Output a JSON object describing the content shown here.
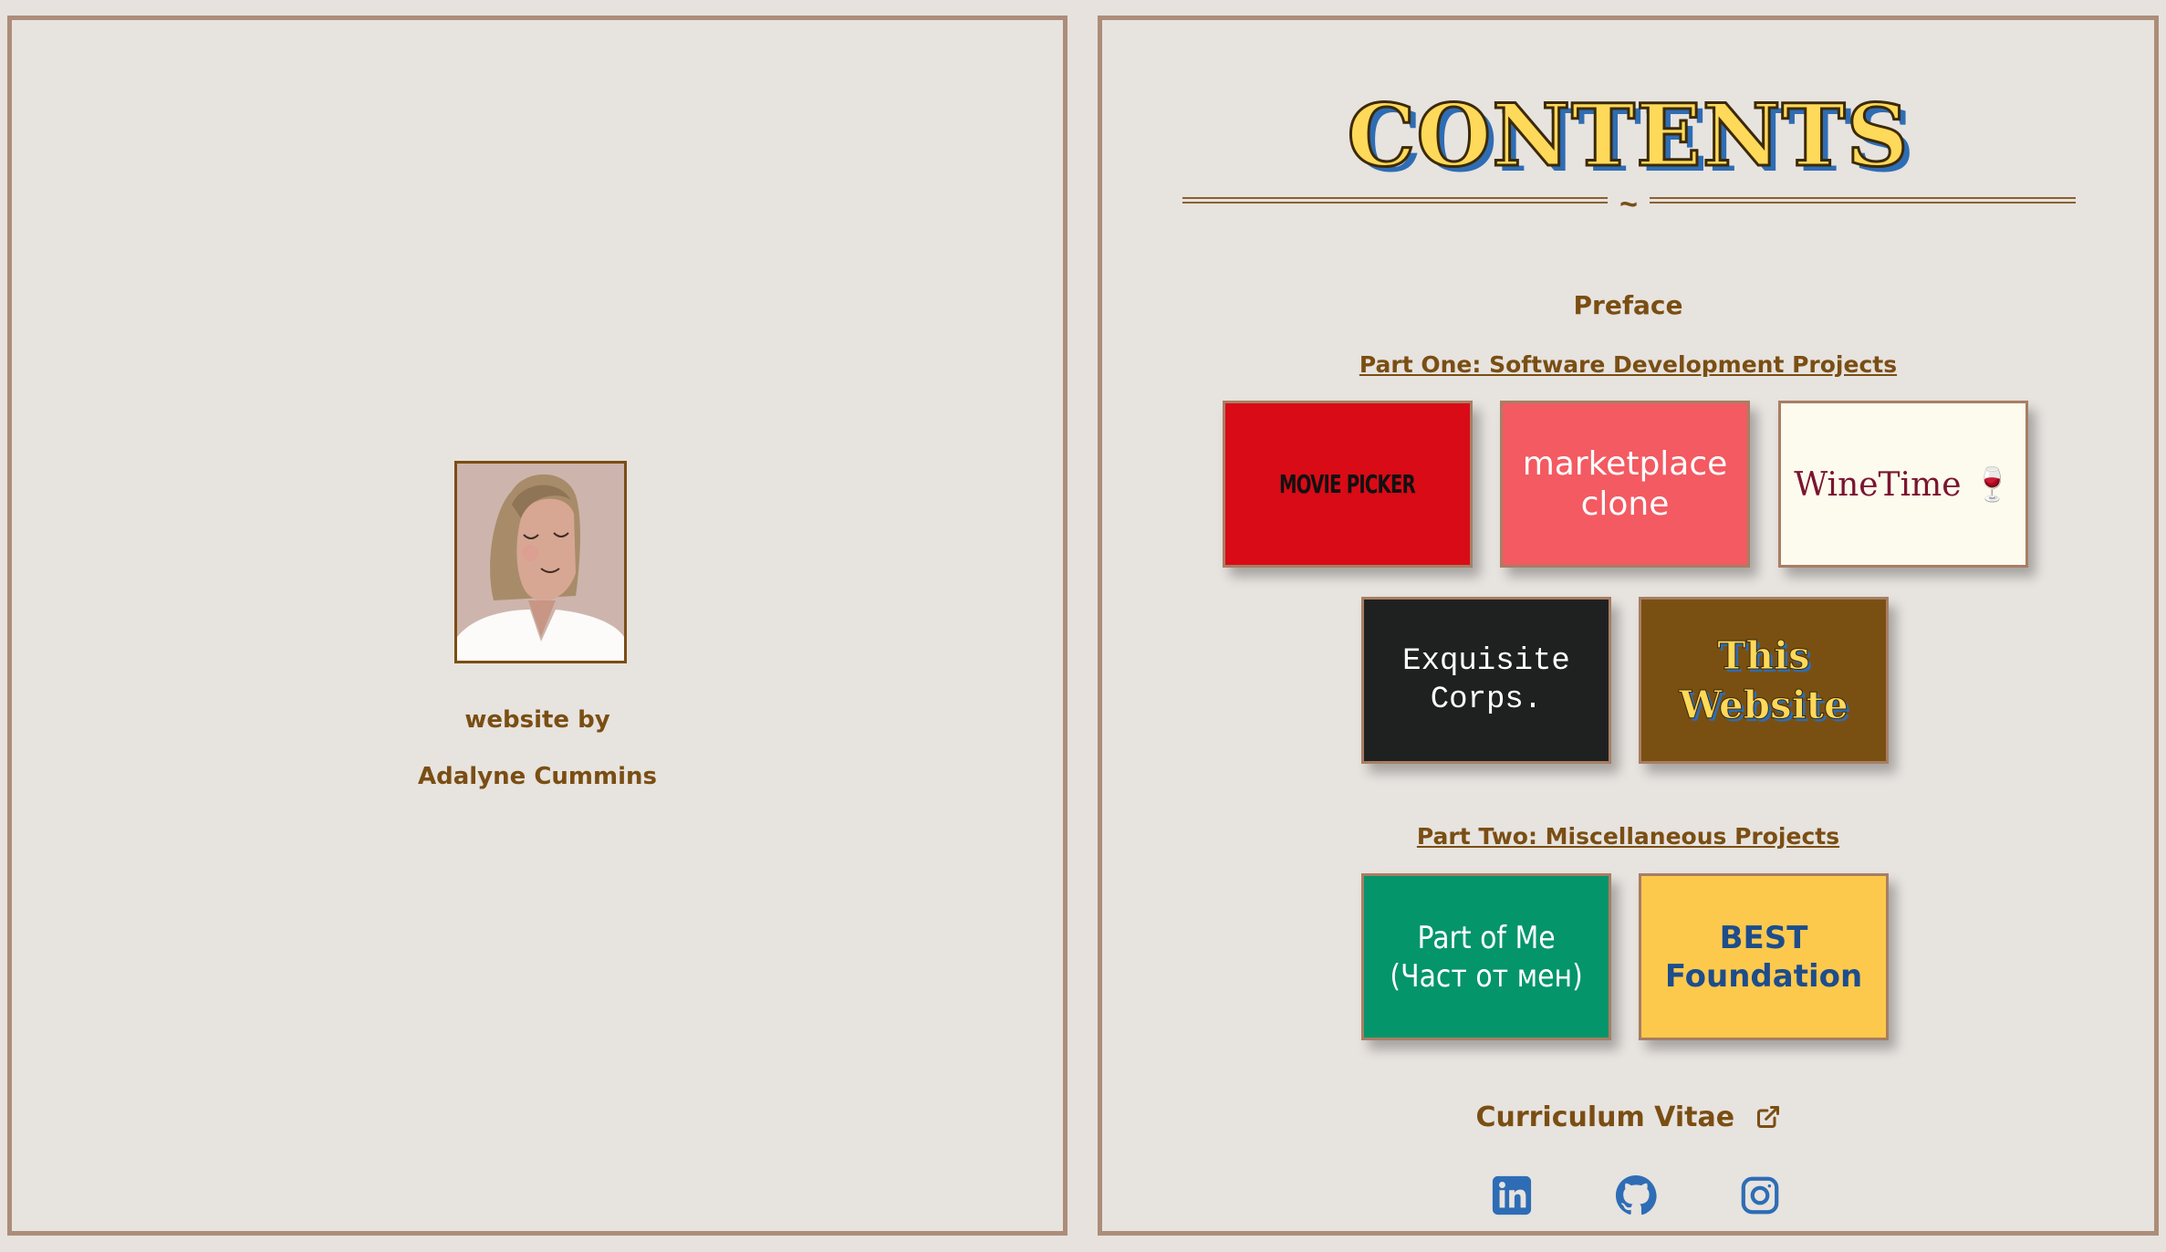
{
  "left_page": {
    "byline_label": "website by",
    "author_name": "Adalyne Cummins"
  },
  "right_page": {
    "title": "CONTENTS",
    "divider_glyph": "~",
    "preface": "Preface",
    "part_one": "Part One: Software Development Projects",
    "part_two": "Part Two: Miscellaneous Projects",
    "projects_part_one": [
      {
        "line1": "MOVIE PICKER",
        "line2": ""
      },
      {
        "line1": "marketplace",
        "line2": "clone"
      },
      {
        "line1": "WineTime 🍷",
        "line2": ""
      },
      {
        "line1": "Exquisite",
        "line2": "Corps."
      },
      {
        "line1": "This",
        "line2": "Website"
      }
    ],
    "projects_part_two": [
      {
        "line1": "Part of Me",
        "line2": "(Част от мен)"
      },
      {
        "line1": "BEST",
        "line2": "Foundation"
      }
    ],
    "cv_label": "Curriculum Vitae",
    "social_icons": [
      "linkedin-icon",
      "github-icon",
      "instagram-icon"
    ]
  },
  "colors": {
    "page_bg": "#e7e3df",
    "page_border": "#ac8d79",
    "accent_brown": "#7a4e13",
    "title_yellow": "#ffd95a",
    "title_shadow_blue": "#2e6db5",
    "social_blue": "#2e6db5"
  }
}
